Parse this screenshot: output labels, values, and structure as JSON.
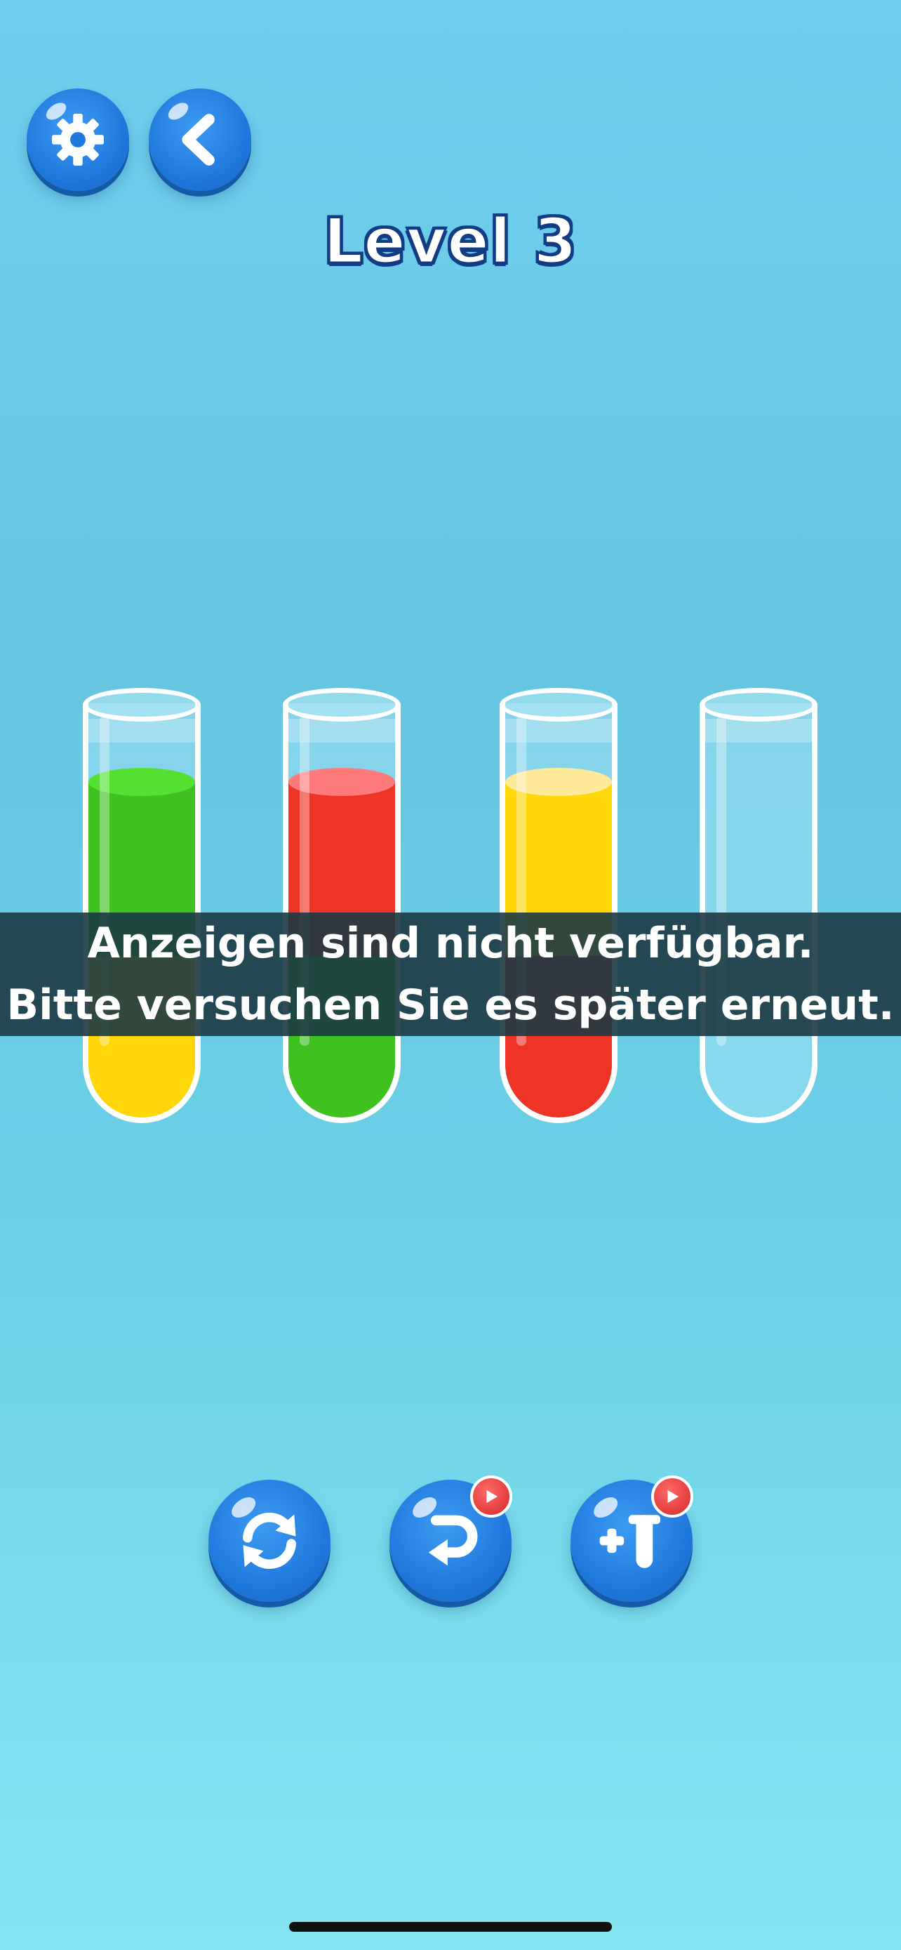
{
  "header": {
    "level_title": "Level 3",
    "settings_icon": "gear-icon",
    "back_icon": "chevron-left-icon"
  },
  "tubes": [
    {
      "name": "tube-1",
      "layers_top_to_bottom": [
        "green",
        "yellow"
      ]
    },
    {
      "name": "tube-2",
      "layers_top_to_bottom": [
        "red",
        "green"
      ]
    },
    {
      "name": "tube-3",
      "layers_top_to_bottom": [
        "yellow",
        "red"
      ]
    },
    {
      "name": "tube-4",
      "layers_top_to_bottom": []
    }
  ],
  "colors": {
    "green": "#3fc11f",
    "green_surface": "#54e030",
    "red": "#ee3327",
    "red_surface": "#ff7b7b",
    "yellow": "#ffd60a",
    "yellow_surface": "#ffe99a",
    "button_blue": "#1f78dc",
    "badge_red": "#e23b3b"
  },
  "ad_notice": {
    "line1": "Anzeigen sind nicht verfügbar.",
    "line2": "Bitte versuchen Sie es später erneut."
  },
  "actions": {
    "restart_icon": "refresh-icon",
    "undo_icon": "undo-icon",
    "add_tube_icon": "add-tube-icon",
    "video_badge_icon": "video-play-icon"
  }
}
